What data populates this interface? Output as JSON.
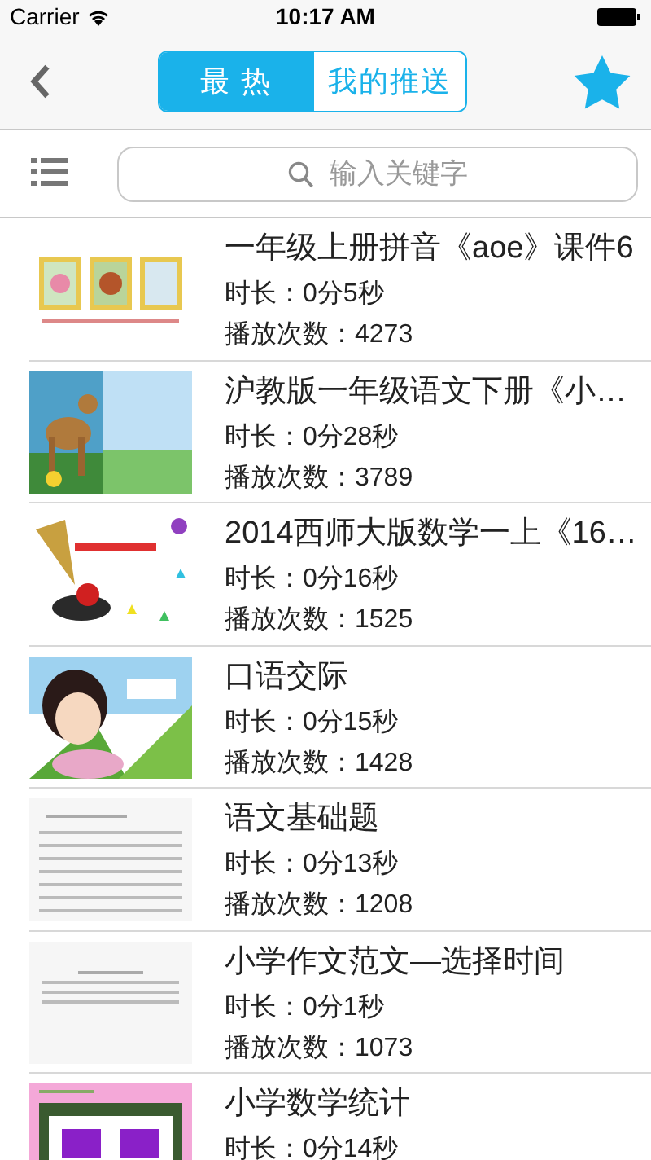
{
  "status_bar": {
    "carrier": "Carrier",
    "time": "10:17 AM"
  },
  "nav": {
    "tabs": [
      {
        "label": "最 热",
        "selected": true
      },
      {
        "label": "我的推送",
        "selected": false
      }
    ]
  },
  "search": {
    "placeholder": "输入关键字"
  },
  "videos": [
    {
      "title": "一年级上册拼音《aoe》课件6",
      "duration": "时长：0分5秒",
      "plays": "播放次数：4273"
    },
    {
      "title": "沪教版一年级语文下册《小…",
      "duration": "时长：0分28秒",
      "plays": "播放次数：3789"
    },
    {
      "title": "2014西师大版数学一上《16…",
      "duration": "时长：0分16秒",
      "plays": "播放次数：1525"
    },
    {
      "title": "口语交际",
      "duration": "时长：0分15秒",
      "plays": "播放次数：1428"
    },
    {
      "title": "语文基础题",
      "duration": "时长：0分13秒",
      "plays": "播放次数：1208"
    },
    {
      "title": "小学作文范文—选择时间",
      "duration": "时长：0分1秒",
      "plays": "播放次数：1073"
    },
    {
      "title": "小学数学统计",
      "duration": "时长：0分14秒"
    }
  ]
}
